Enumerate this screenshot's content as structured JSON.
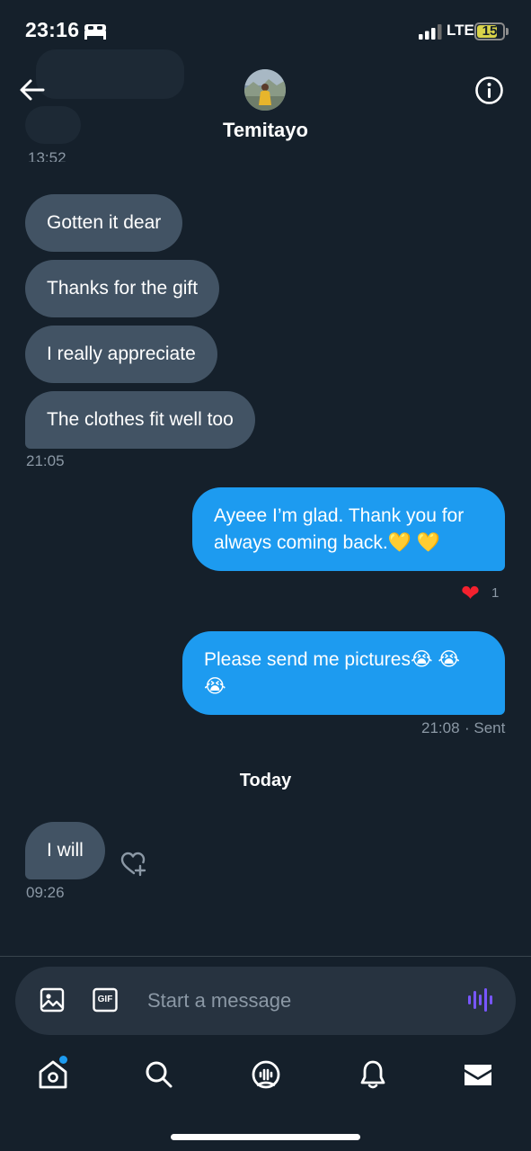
{
  "status_bar": {
    "time": "23:16",
    "network": "LTE",
    "battery": "15"
  },
  "header": {
    "contact_name": "Temitayo"
  },
  "conversation": {
    "partial_timestamp": "13:52",
    "received_group_1": {
      "messages": [
        "Gotten it dear",
        "Thanks for the gift",
        "I really appreciate",
        "The clothes fit well too"
      ],
      "timestamp": "21:05"
    },
    "sent_1": {
      "line_1": "Ayeee I’m glad. Thank you for",
      "line_2": "always coming back.",
      "emoji": "💛 💛",
      "reaction_emoji": "❤",
      "reaction_count": "1"
    },
    "sent_2": {
      "line_1": "Please send me pictures",
      "emoji_inline": "😭 😭",
      "emoji_line_2": "😭",
      "timestamp": "21:08",
      "status": "· Sent"
    },
    "day_separator": "Today",
    "received_group_2": {
      "message": "I will",
      "timestamp": "09:26"
    }
  },
  "composer": {
    "placeholder": "Start a message",
    "gif_label": "GIF"
  },
  "tab_bar": {
    "items": [
      "home-icon",
      "search-icon",
      "spaces-icon",
      "notifications-icon",
      "messages-icon"
    ]
  },
  "colors": {
    "background": "#15202b",
    "incoming_bubble": "#425364",
    "outgoing_bubble": "#1d9bf0",
    "accent": "#1d9bf0",
    "muted_text": "#8b98a5",
    "voice_accent": "#7856ff"
  }
}
